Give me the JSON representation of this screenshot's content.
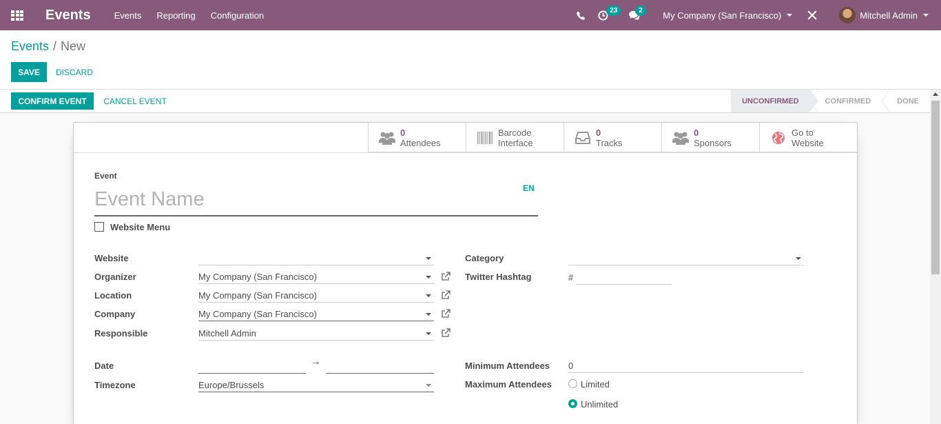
{
  "app": {
    "title": "Events"
  },
  "nav": {
    "menus": [
      "Events",
      "Reporting",
      "Configuration"
    ],
    "activity_count": "23",
    "messages_count": "2",
    "company": "My Company (San Francisco)",
    "user": "Mitchell Admin"
  },
  "breadcrumb": {
    "parent": "Events",
    "current": "New"
  },
  "actions": {
    "save": "Save",
    "discard": "Discard",
    "confirm": "Confirm Event",
    "cancel": "Cancel Event"
  },
  "stages": {
    "unconfirmed": "Unconfirmed",
    "confirmed": "Confirmed",
    "done": "Done",
    "active": "Unconfirmed"
  },
  "smart_buttons": {
    "attendees": {
      "count": "0",
      "label": "Attendees"
    },
    "barcode": {
      "line1": "Barcode",
      "line2": "Interface"
    },
    "tracks": {
      "count": "0",
      "label": "Tracks"
    },
    "sponsors": {
      "count": "0",
      "label": "Sponsors"
    },
    "website": {
      "line1": "Go to",
      "line2": "Website"
    }
  },
  "form": {
    "event_label": "Event",
    "event_name_placeholder": "Event Name",
    "lang": "EN",
    "website_menu_label": "Website Menu",
    "website_label": "Website",
    "website_value": "",
    "organizer_label": "Organizer",
    "organizer_value": "My Company (San Francisco)",
    "location_label": "Location",
    "location_value": "My Company (San Francisco)",
    "company_label": "Company",
    "company_value": "My Company (San Francisco)",
    "responsible_label": "Responsible",
    "responsible_value": "Mitchell Admin",
    "category_label": "Category",
    "category_value": "",
    "twitter_label": "Twitter Hashtag",
    "twitter_prefix": "#",
    "twitter_value": "",
    "date_label": "Date",
    "date_arrow": "→",
    "timezone_label": "Timezone",
    "timezone_value": "Europe/Brussels",
    "min_attendees_label": "Minimum Attendees",
    "min_attendees_value": "0",
    "max_attendees_label": "Maximum Attendees",
    "limited_label": "Limited",
    "unlimited_label": "Unlimited"
  },
  "colors": {
    "brand": "#875a7b",
    "accent": "#00a09d"
  }
}
